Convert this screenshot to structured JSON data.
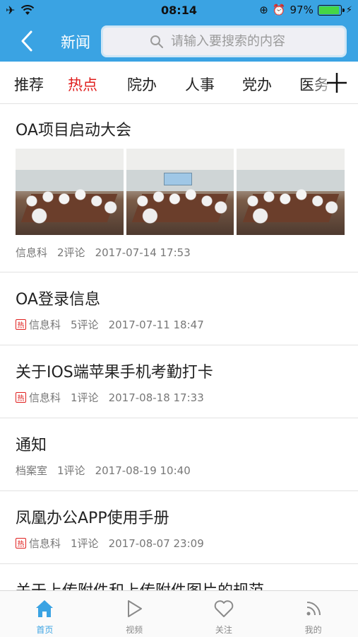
{
  "status_bar": {
    "time": "08:14",
    "battery": "97%"
  },
  "header": {
    "title": "新闻",
    "search_placeholder": "请输入要搜索的内容"
  },
  "tabs": [
    {
      "label": "推荐",
      "active": false
    },
    {
      "label": "热点",
      "active": true
    },
    {
      "label": "院办",
      "active": false
    },
    {
      "label": "人事",
      "active": false
    },
    {
      "label": "党办",
      "active": false
    },
    {
      "label": "医务",
      "active": false
    }
  ],
  "feed": [
    {
      "title": "OA项目启动大会",
      "hot": false,
      "source": "信息科",
      "comments": "2评论",
      "datetime": "2017-07-14 17:53",
      "has_photos": true
    },
    {
      "title": "OA登录信息",
      "hot": true,
      "hot_label": "热",
      "source": "信息科",
      "comments": "5评论",
      "datetime": "2017-07-11 18:47"
    },
    {
      "title": "关于IOS端苹果手机考勤打卡",
      "hot": true,
      "hot_label": "热",
      "source": "信息科",
      "comments": "1评论",
      "datetime": "2017-08-18 17:33"
    },
    {
      "title": "通知",
      "hot": false,
      "source": "档案室",
      "comments": "1评论",
      "datetime": "2017-08-19 10:40"
    },
    {
      "title": "凤凰办公APP使用手册",
      "hot": true,
      "hot_label": "热",
      "source": "信息科",
      "comments": "1评论",
      "datetime": "2017-08-07 23:09"
    },
    {
      "title": "关于上传附件和上传附件图片的规范",
      "hot": false
    }
  ],
  "tabbar": [
    {
      "label": "首页",
      "icon": "home-icon",
      "active": true
    },
    {
      "label": "视频",
      "icon": "play-icon",
      "active": false
    },
    {
      "label": "关注",
      "icon": "heart-icon",
      "active": false
    },
    {
      "label": "我的",
      "icon": "rss-icon",
      "active": false
    }
  ],
  "colors": {
    "primary": "#3aa3e3",
    "active_tab": "#e0201f",
    "hot_tag": "#e0201f"
  }
}
